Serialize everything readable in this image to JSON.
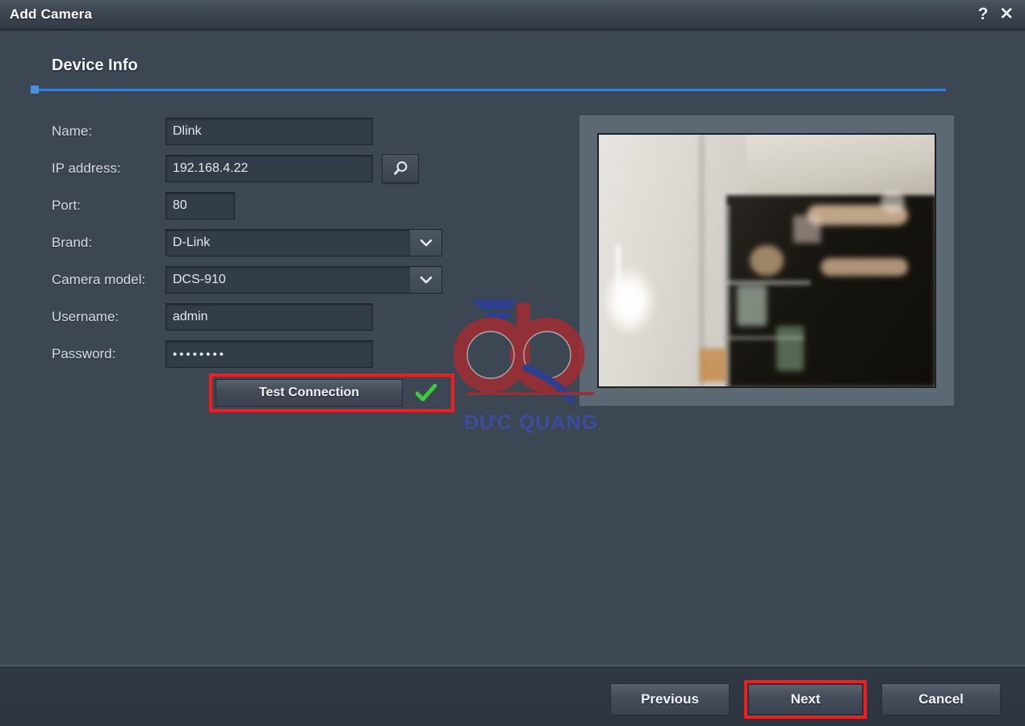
{
  "window": {
    "title": "Add Camera",
    "help_icon": "?",
    "close_icon": "✕"
  },
  "step": {
    "title": "Device Info",
    "accent_color": "#3b7fd4",
    "progress_percent": 0
  },
  "form": {
    "fields": [
      {
        "label": "Name:",
        "value": "Dlink",
        "type": "text"
      },
      {
        "label": "IP address:",
        "value": "192.168.4.22",
        "type": "text-with-search"
      },
      {
        "label": "Port:",
        "value": "80",
        "type": "text-small"
      },
      {
        "label": "Brand:",
        "value": "D-Link",
        "type": "dropdown"
      },
      {
        "label": "Camera model:",
        "value": "DCS-910",
        "type": "dropdown"
      },
      {
        "label": "Username:",
        "value": "admin",
        "type": "text"
      },
      {
        "label": "Password:",
        "value": "••••••••",
        "type": "password"
      }
    ],
    "search_icon": "magnifier-icon",
    "dropdown_icon": "chevron-down-icon"
  },
  "test_connection": {
    "label": "Test Connection",
    "status_icon": "green-check-icon",
    "status_color": "#3ec93e",
    "highlight_color": "#f41c1c"
  },
  "preview": {
    "label": "camera-live-preview"
  },
  "watermark": {
    "logo_text": "dq",
    "brand_text": "ĐỨC QUANG",
    "logo_color": "#9b2e35",
    "brand_color": "#3b4fa8"
  },
  "footer": {
    "buttons": [
      {
        "label": "Previous",
        "highlighted": false
      },
      {
        "label": "Next",
        "highlighted": true
      },
      {
        "label": "Cancel",
        "highlighted": false
      }
    ]
  },
  "colors": {
    "window_bg": "#3d4653",
    "titlebar_bg": "#3b4450",
    "field_bg": "#333c49",
    "footer_bg": "#2c343f",
    "preview_frame": "#5d6875"
  }
}
